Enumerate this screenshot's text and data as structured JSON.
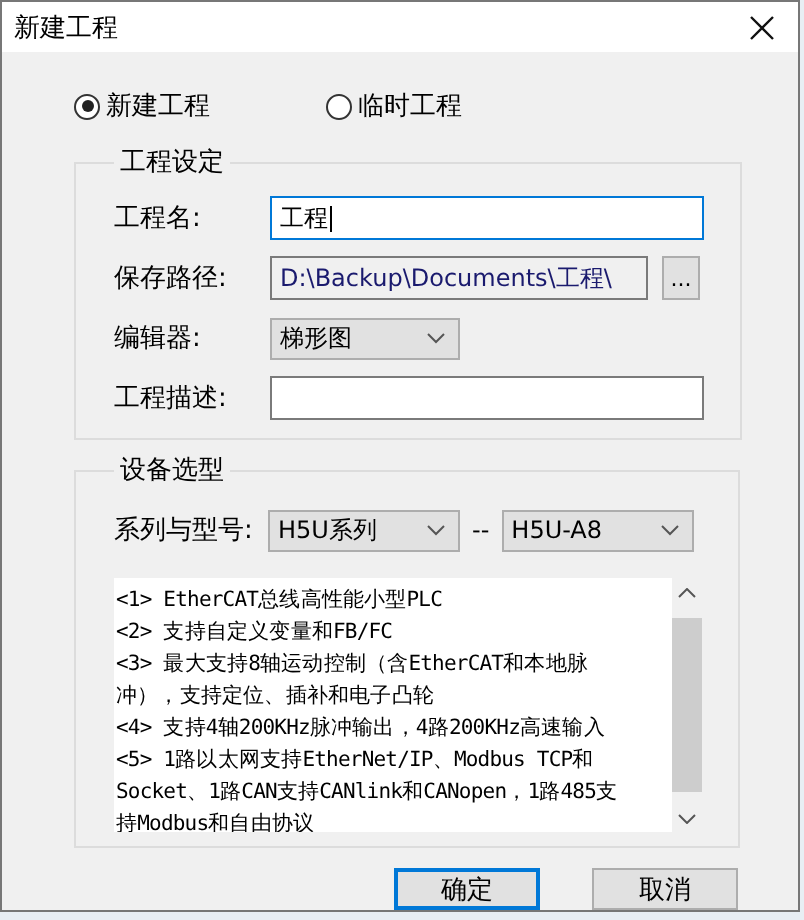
{
  "window": {
    "title": "新建工程"
  },
  "project_type": [
    {
      "label": "新建工程",
      "selected": true
    },
    {
      "label": "临时工程",
      "selected": false
    }
  ],
  "project_settings": {
    "title": "工程设定",
    "name": {
      "label": "工程名:",
      "value": "工程",
      "focused": true
    },
    "save_path": {
      "label": "保存路径:",
      "value": "D:\\Backup\\Documents\\工程\\",
      "browse": "..."
    },
    "editor": {
      "label": "编辑器:",
      "value": "梯形图"
    },
    "description": {
      "label": "工程描述:"
    }
  },
  "device_selection": {
    "title": "设备选型",
    "label": "系列与型号:",
    "series": "H5U系列",
    "separator": "--",
    "model": "H5U-A8",
    "info_lines": [
      "<1> EtherCAT总线高性能小型PLC",
      "<2> 支持自定义变量和FB/FC",
      "<3> 最大支持8轴运动控制（含EtherCAT和本地脉",
      "冲），支持定位、插补和电子凸轮",
      "<4> 支持4轴200KHz脉冲输出，4路200KHz高速输入",
      "<5> 1路以太网支持EtherNet/IP、Modbus TCP和",
      "Socket、1路CAN支持CANlink和CANopen，1路485支",
      "持Modbus和自由协议"
    ]
  },
  "buttons": [
    {
      "label": "确定",
      "default": true
    },
    {
      "label": "取消",
      "default": false
    }
  ]
}
